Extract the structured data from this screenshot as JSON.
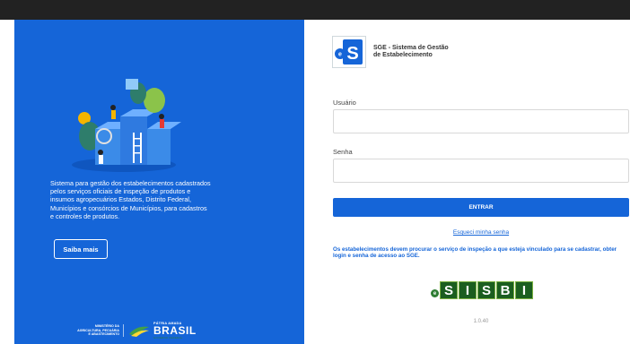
{
  "left": {
    "intro": "Sistema para gestão dos estabelecimentos cadastrados pelos serviços oficiais de inspeção de produtos e insumos agropecuários Estados, Distrito Federal, Municípios e consórcios de Municípios, para cadastros e controles de produtos.",
    "saiba_mais": "Saiba mais",
    "gov": {
      "ministry_line1": "MINISTÉRIO DA",
      "ministry_line2": "AGRICULTURA, PECUÁRIA",
      "ministry_line3": "E ABASTECIMENTO",
      "patria": "PÁTRIA AMADA",
      "brasil": "BRASIL",
      "gov_fed": "GOVERNO FEDERAL"
    }
  },
  "brand": {
    "logo_text": "eS",
    "line1": "SGE - Sistema de Gestão",
    "line2": "de Estabelecimento"
  },
  "form": {
    "user_label": "Usuário",
    "user_value": "",
    "password_label": "Senha",
    "password_value": "",
    "enter_label": "ENTRAR",
    "forgot_label": "Esqueci minha senha",
    "notice": "Os estabelecimentos devem procurar o serviço de inspeção a que esteja vinculado para se cadastrar, obter login e senha de acesso ao SGE."
  },
  "sisbi": {
    "e": "e",
    "letters": [
      "S",
      "I",
      "S",
      "B",
      "I"
    ]
  },
  "version": "1.0.40",
  "colors": {
    "primary": "#1565d8",
    "topbar": "#222222",
    "sisbi_green": "#1b5e20"
  }
}
